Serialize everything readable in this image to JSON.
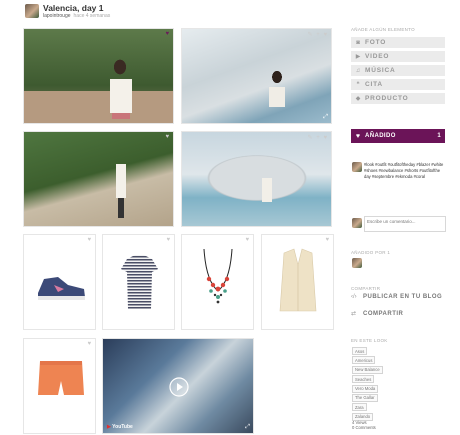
{
  "header": {
    "title": "Valencia, day 1",
    "username": "lapointrouge",
    "time_ago": "hace 4 semanas"
  },
  "tiles": {
    "photo1": {
      "label": "outfit-photo-white-blazer"
    },
    "video": {
      "badge": "YouTube"
    }
  },
  "sidebar": {
    "add_element_label": "Añade algún elemento",
    "add_buttons": [
      {
        "icon": "camera-icon",
        "label": "FOTO"
      },
      {
        "icon": "play-icon",
        "label": "VIDEO"
      },
      {
        "icon": "music-icon",
        "label": "MÚSICA"
      },
      {
        "icon": "quote-icon",
        "label": "CITA"
      },
      {
        "icon": "tag-icon",
        "label": "PRODUCTO"
      }
    ],
    "added": {
      "label": "AÑADIDO",
      "count": "1"
    },
    "hashtags": "#look #outfit #outfitoftheday #blazer #white #shoes #newbalance #shorts #outfitofthe day #septembre #ekmoda #coral",
    "comment_placeholder": "Escribe un comentario...",
    "added_by_label": "Añadido por 1",
    "share_label": "Compartir",
    "publish_label": "PUBLICAR EN TU BLOG",
    "share_button_label": "COMPARTIR",
    "in_this_look_label": "En este look",
    "tags": [
      "Asos",
      "Americus",
      "New Balance",
      "Seaches",
      "Vero Moda",
      "The Gallar",
      "Zara",
      "Zalando"
    ],
    "views": "4 Views",
    "comments": "0 Comments"
  },
  "colors": {
    "accent": "#6b1458",
    "button_bg": "#ebebeb"
  }
}
